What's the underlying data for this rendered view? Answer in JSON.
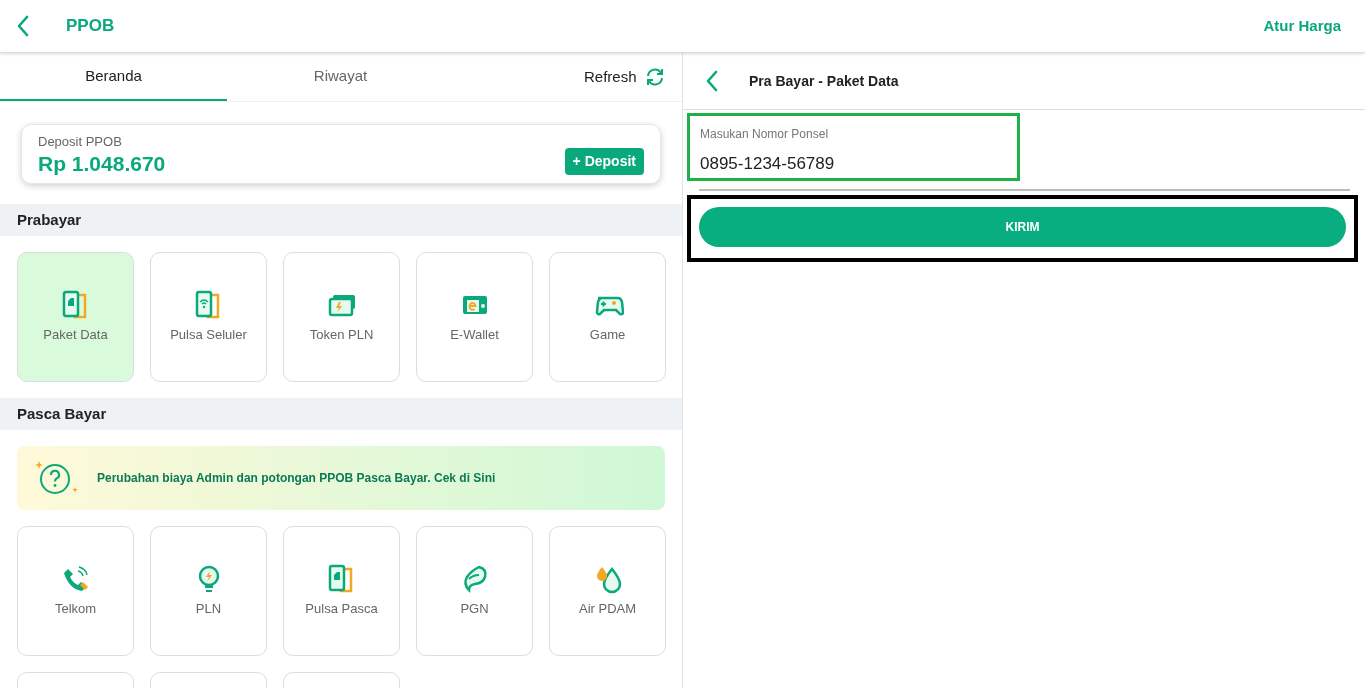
{
  "header": {
    "title": "PPOB",
    "action": "Atur Harga"
  },
  "tabs": [
    {
      "label": "Beranda",
      "selected": true
    },
    {
      "label": "Riwayat",
      "selected": false
    }
  ],
  "refresh": {
    "label": "Refresh"
  },
  "deposit": {
    "label": "Deposit PPOB",
    "amount": "Rp 1.048.670",
    "button": "+ Deposit"
  },
  "prabayar": {
    "title": "Prabayar",
    "items": [
      {
        "kind": "service",
        "label": "Paket Data",
        "selected": true
      },
      {
        "kind": "service",
        "label": "Pulsa Seluler",
        "selected": false
      },
      {
        "kind": "service",
        "label": "Token PLN",
        "selected": false
      },
      {
        "kind": "service",
        "label": "E-Wallet",
        "selected": false
      },
      {
        "kind": "service",
        "label": "Game",
        "selected": false
      }
    ]
  },
  "pasca_bayar": {
    "title": "Pasca Bayar",
    "notice": "Perubahan biaya Admin dan potongan PPOB Pasca Bayar. **Cek di Sini**",
    "items": [
      {
        "kind": "service",
        "label": "Telkom",
        "selected": false
      },
      {
        "kind": "service",
        "label": "PLN",
        "selected": false
      },
      {
        "kind": "service",
        "label": "Pulsa Pasca",
        "selected": false
      },
      {
        "kind": "service",
        "label": "PGN",
        "selected": false
      },
      {
        "kind": "service",
        "label": "Air PDAM",
        "selected": false
      },
      {
        "kind": "partial",
        "selected": false
      },
      {
        "kind": "partial",
        "selected": false
      },
      {
        "kind": "partial",
        "selected": false
      }
    ]
  },
  "detail": {
    "title": "Pra Bayar - Paket Data",
    "phone_field": {
      "label": "Masukan Nomor Ponsel",
      "value": "0895-1234-56789"
    },
    "submit": "KIRIM"
  }
}
